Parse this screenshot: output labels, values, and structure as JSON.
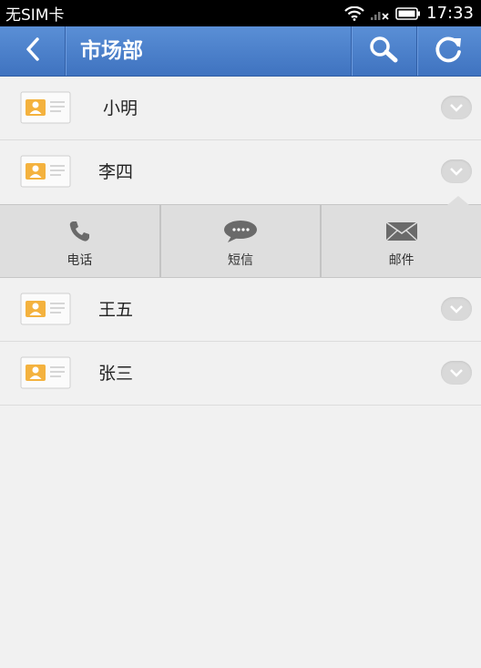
{
  "status_bar": {
    "carrier": "无SIM卡",
    "time": "17:33",
    "icons": [
      "wifi-icon",
      "signal-icon",
      "battery-icon"
    ]
  },
  "title_bar": {
    "title": "市场部",
    "icons": [
      "back-arrow-icon",
      "search-icon",
      "refresh-icon"
    ]
  },
  "contacts": [
    {
      "name": "小明",
      "icon": "contact-card-icon",
      "expanded": false
    },
    {
      "name": "李四",
      "icon": "contact-card-icon",
      "expanded": true
    },
    {
      "name": "王五",
      "icon": "contact-card-icon",
      "expanded": false
    },
    {
      "name": "张三",
      "icon": "contact-card-icon",
      "expanded": false
    }
  ],
  "actions": [
    {
      "label": "电话",
      "icon": "phone-icon"
    },
    {
      "label": "短信",
      "icon": "sms-icon"
    },
    {
      "label": "邮件",
      "icon": "mail-icon"
    }
  ],
  "colors": {
    "title_bar": "#4a7fcb",
    "background": "#f1f1f1",
    "card_accent": "#f4b23e"
  }
}
